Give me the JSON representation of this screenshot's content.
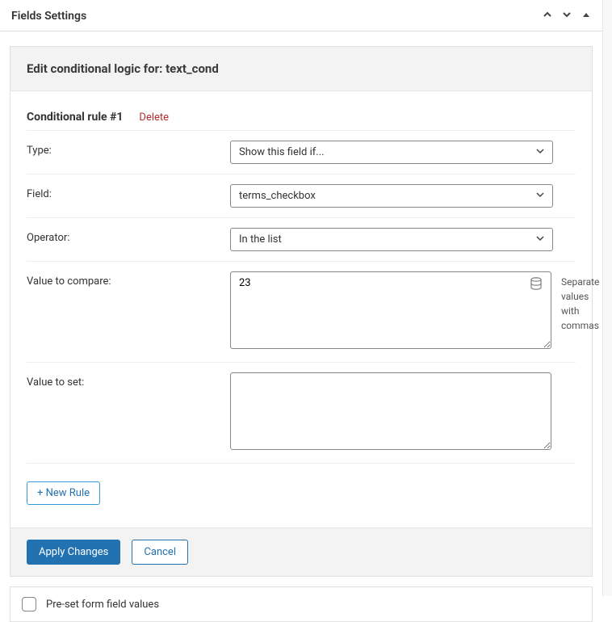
{
  "panel": {
    "title": "Fields Settings"
  },
  "card": {
    "title": "Edit conditional logic for: text_cond"
  },
  "rule": {
    "title": "Conditional rule #1",
    "delete_label": "Delete",
    "rows": {
      "type": {
        "label": "Type:",
        "value": "Show this field if..."
      },
      "field": {
        "label": "Field:",
        "value": "terms_checkbox"
      },
      "operator": {
        "label": "Operator:",
        "value": "In the list"
      },
      "value_compare": {
        "label": "Value to compare:",
        "value": "23",
        "hint": "Separate values with commas"
      },
      "value_set": {
        "label": "Value to set:",
        "value": ""
      }
    }
  },
  "buttons": {
    "new_rule": "+ New Rule",
    "apply": "Apply Changes",
    "cancel": "Cancel"
  },
  "preset": {
    "label": "Pre-set form field values"
  }
}
